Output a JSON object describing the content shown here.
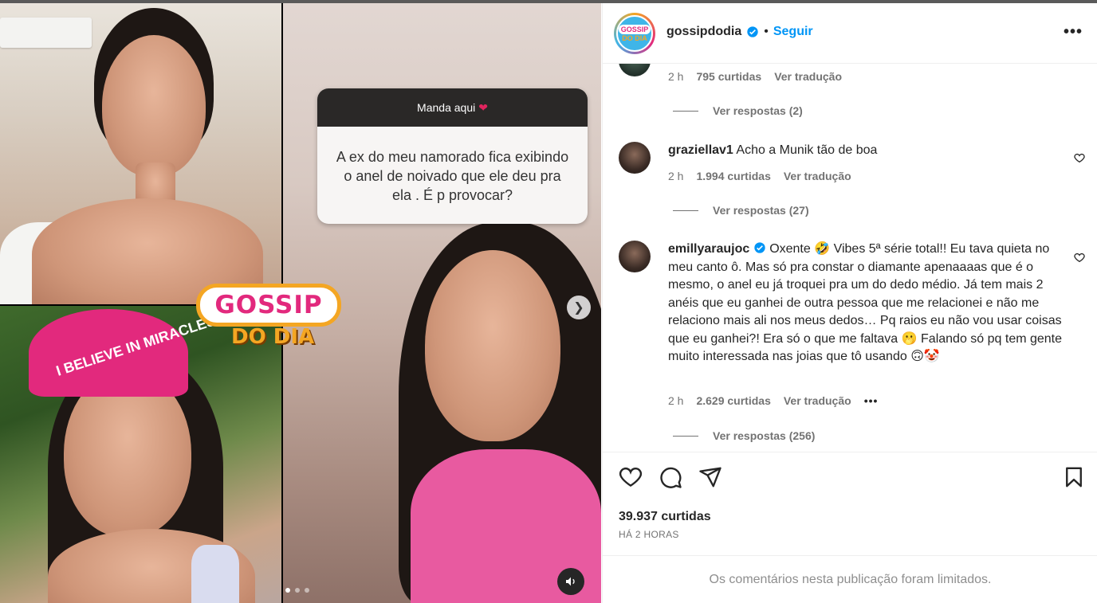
{
  "post": {
    "question_header": "Manda aqui",
    "question_text": "A ex do meu namorado fica exibindo o anel de noivado que ele deu pra ela . É p provocar?",
    "logo_top": "GOSSIP",
    "logo_bottom": "DO DIA",
    "cap_text": "I BELIEVE IN MIRACLES",
    "carousel_total": 3,
    "carousel_active": 1
  },
  "header": {
    "avatar_line1": "GOSSIP",
    "avatar_line2": "DO DIA",
    "username": "gossipdodia",
    "bullet": "•",
    "follow": "Seguir",
    "more": "•••"
  },
  "comments": [
    {
      "time": "2 h",
      "likes": "795 curtidas",
      "translate": "Ver tradução",
      "replies": "Ver respostas (2)"
    },
    {
      "username": "graziellav1",
      "text": "Acho a Munik tão de boa",
      "time": "2 h",
      "likes": "1.994 curtidas",
      "translate": "Ver tradução",
      "replies": "Ver respostas (27)"
    },
    {
      "username": "emillyaraujoc",
      "text": "Oxente 🤣 Vibes 5ª série total!! Eu tava quieta no meu canto ô. Mas só pra constar o diamante apenaaaas que é o mesmo, o anel eu já troquei pra um do dedo médio. Já tem mais 2 anéis que eu ganhei de outra pessoa que me relacionei e não me relaciono mais ali nos meus dedos… Pq raios eu não vou usar coisas que eu ganhei?! Era só o que me faltava 🫢 Falando só pq tem gente muito interessada nas joias que tô usando 🙃🤡",
      "time": "2 h",
      "likes": "2.629 curtidas",
      "translate": "Ver tradução",
      "more": "•••",
      "replies": "Ver respostas (256)"
    }
  ],
  "actions": {
    "likes": "39.937 curtidas",
    "time_ago": "HÁ 2 HORAS"
  },
  "footer": {
    "limited": "Os comentários nesta publicação foram limitados."
  },
  "colors": {
    "follow_blue": "#0095f6",
    "muted_text": "#737373",
    "brand_pink": "#e2297d",
    "brand_orange": "#f4a623"
  },
  "icons": [
    "heart-icon",
    "comment-icon",
    "share-icon",
    "bookmark-icon",
    "verified-icon",
    "chevron-right-icon",
    "volume-icon",
    "more-icon"
  ]
}
